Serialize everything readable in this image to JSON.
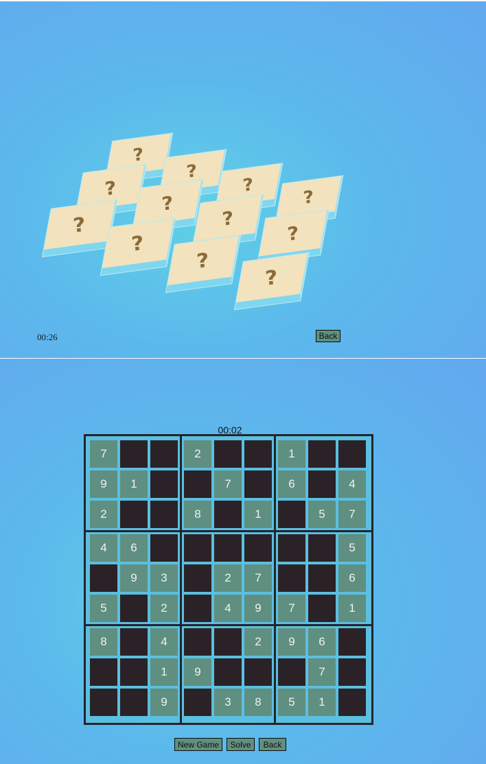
{
  "memory_game": {
    "timer": "00:26",
    "back_label": "Back",
    "tile_symbol": "?",
    "rows": [
      [
        "?",
        "?",
        "?",
        "?"
      ],
      [
        "?",
        "?",
        "?",
        "?"
      ],
      [
        "?",
        "?",
        "?",
        "?"
      ]
    ]
  },
  "sudoku": {
    "timer": "00:02",
    "grid": [
      [
        "7",
        "",
        "",
        "2",
        "",
        "",
        "1",
        "",
        ""
      ],
      [
        "9",
        "1",
        "",
        "",
        "7",
        "",
        "6",
        "",
        "4"
      ],
      [
        "2",
        "",
        "",
        "8",
        "",
        "1",
        "",
        "5",
        "7"
      ],
      [
        "4",
        "6",
        "",
        "",
        "",
        "",
        "",
        "",
        "5"
      ],
      [
        "",
        "9",
        "3",
        "",
        "2",
        "7",
        "",
        "",
        "6"
      ],
      [
        "5",
        "",
        "2",
        "",
        "4",
        "9",
        "7",
        "",
        "1"
      ],
      [
        "8",
        "",
        "4",
        "",
        "",
        "2",
        "9",
        "6",
        ""
      ],
      [
        "",
        "",
        "1",
        "9",
        "",
        "",
        "",
        "7",
        ""
      ],
      [
        "",
        "",
        "9",
        "",
        "3",
        "8",
        "5",
        "1",
        ""
      ]
    ],
    "buttons": {
      "new_game": "New Game",
      "solve": "Solve",
      "back": "Back"
    }
  },
  "colors": {
    "background": "#5cb8ec",
    "tile_face": "#f2e2bd",
    "question_mark": "#8a6b3a",
    "filled_cell": "#5f8f80",
    "empty_cell": "#2a2226",
    "grid_border": "#23242b"
  }
}
